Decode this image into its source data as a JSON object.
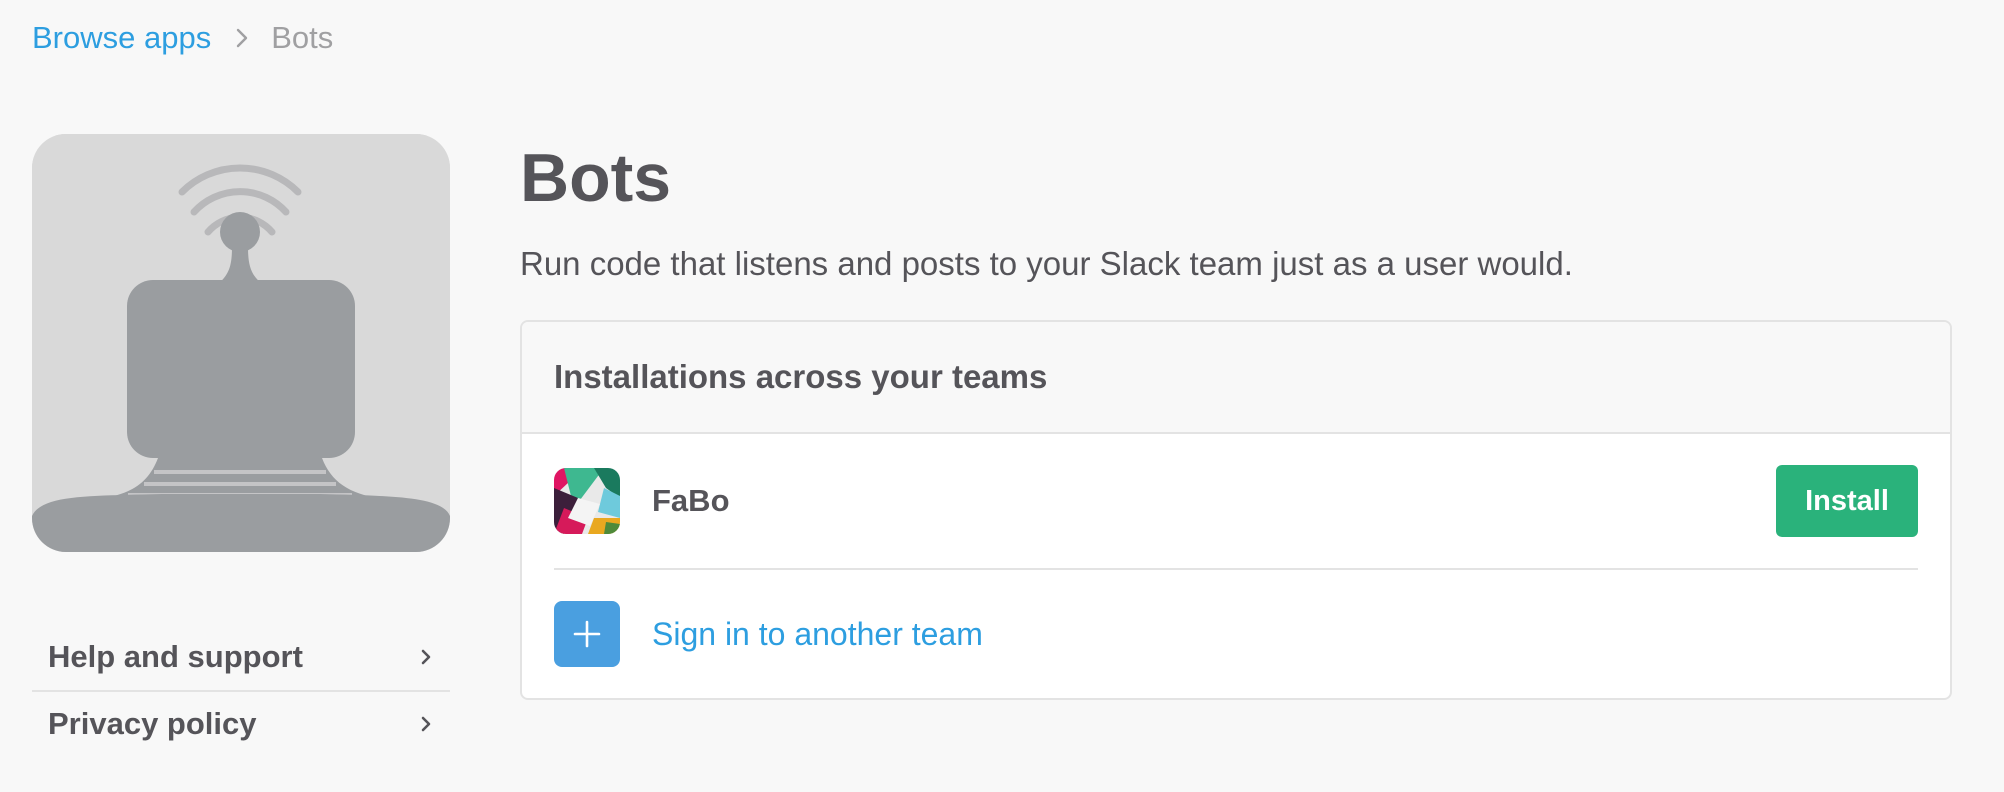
{
  "breadcrumb": {
    "parent_label": "Browse apps",
    "current_label": "Bots"
  },
  "app_image": {
    "icon": "bot-icon"
  },
  "sidebar": {
    "items": [
      {
        "label": "Help and support",
        "icon": "chevron-right-icon"
      },
      {
        "label": "Privacy policy",
        "icon": "chevron-right-icon"
      }
    ]
  },
  "main": {
    "title": "Bots",
    "description": "Run code that listens and posts to your Slack team just as a user would."
  },
  "installations": {
    "header": "Installations across your teams",
    "teams": [
      {
        "name": "FaBo",
        "icon": "slack-team-icon",
        "action_label": "Install"
      }
    ],
    "sign_in_label": "Sign in to another team",
    "sign_in_icon": "plus-icon"
  },
  "colors": {
    "link": "#2d9ee0",
    "install_button": "#2ab27b",
    "plus_box": "#4a9fe0",
    "text": "#555459"
  }
}
